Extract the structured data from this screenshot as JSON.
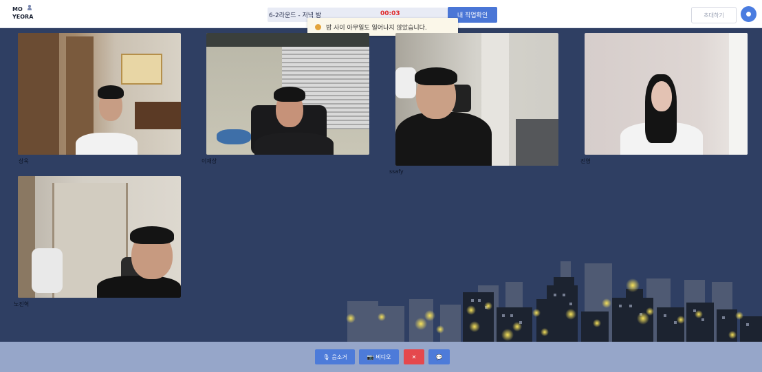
{
  "header": {
    "logo_line1": "MO",
    "logo_line2": "YEORA",
    "round_title": "6-2라운드 - 저녁 밤",
    "round_timer": "00:03",
    "job_button": "내 직업확인",
    "invite_button": "초대하기"
  },
  "toast": {
    "message": "밤 사이 아무일도 일어나지 않았습니다."
  },
  "participants": [
    {
      "name": "상욱"
    },
    {
      "name": "이재상"
    },
    {
      "name": "ssafy"
    },
    {
      "name": "진영"
    },
    {
      "name": "노진혁"
    }
  ],
  "controls": {
    "mute_label": "음소거",
    "video_label": "비디오",
    "leave_label": "✕",
    "chat_label": "💬"
  },
  "colors": {
    "background": "#2f3f63",
    "accent": "#4a76d6",
    "danger": "#e5484d",
    "bottom_bar": "#96a6c9",
    "timer": "#e02a2a"
  }
}
